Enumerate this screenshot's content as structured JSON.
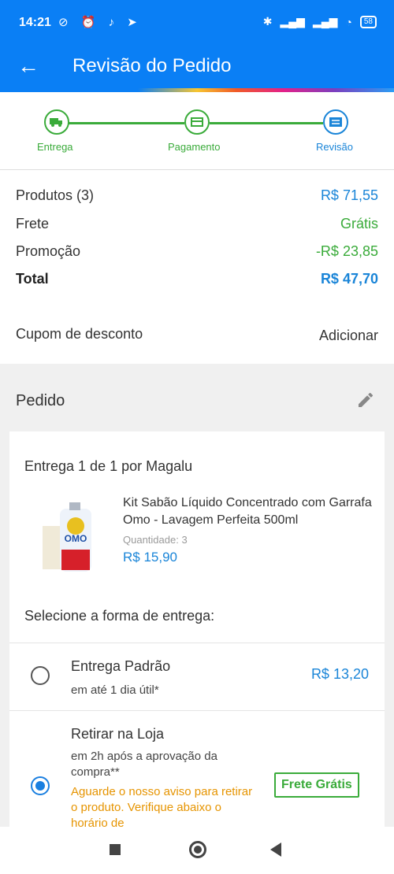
{
  "status_bar": {
    "time": "14:21",
    "battery": "58"
  },
  "app_bar": {
    "title": "Revisão do Pedido"
  },
  "steps": [
    {
      "label": "Entrega"
    },
    {
      "label": "Pagamento"
    },
    {
      "label": "Revisão"
    }
  ],
  "summary": {
    "produtos_label": "Produtos (3)",
    "produtos_value": "R$ 71,55",
    "frete_label": "Frete",
    "frete_value": "Grátis",
    "promocao_label": "Promoção",
    "promocao_value": "-R$ 23,85",
    "total_label": "Total",
    "total_value": "R$ 47,70"
  },
  "coupon": {
    "label": "Cupom de desconto",
    "action": "Adicionar"
  },
  "order": {
    "section_title": "Pedido",
    "delivery_header": "Entrega 1 de 1 por Magalu",
    "product": {
      "name": "Kit Sabão Líquido Concentrado com Garrafa Omo - Lavagem Perfeita 500ml",
      "quantity_label": "Quantidade:",
      "quantity": "3",
      "price": "R$ 15,90",
      "brand_text": "OMO"
    },
    "select_delivery_label": "Selecione a forma de entrega:",
    "options": [
      {
        "title": "Entrega Padrão",
        "subtitle": "em até 1 dia útil*",
        "price": "R$ 13,20",
        "selected": false
      },
      {
        "title": "Retirar na Loja",
        "subtitle_line1": "em 2h após a aprovação da",
        "subtitle_line2": "compra**",
        "warning": "Aguarde o nosso aviso para retirar o produto. Verifique abaixo o horário de",
        "badge": "Frete Grátis",
        "selected": true
      }
    ]
  },
  "colors": {
    "primary": "#0a7ff5",
    "green": "#3aab3a",
    "price_blue": "#1a85d8",
    "warning": "#e69400"
  }
}
